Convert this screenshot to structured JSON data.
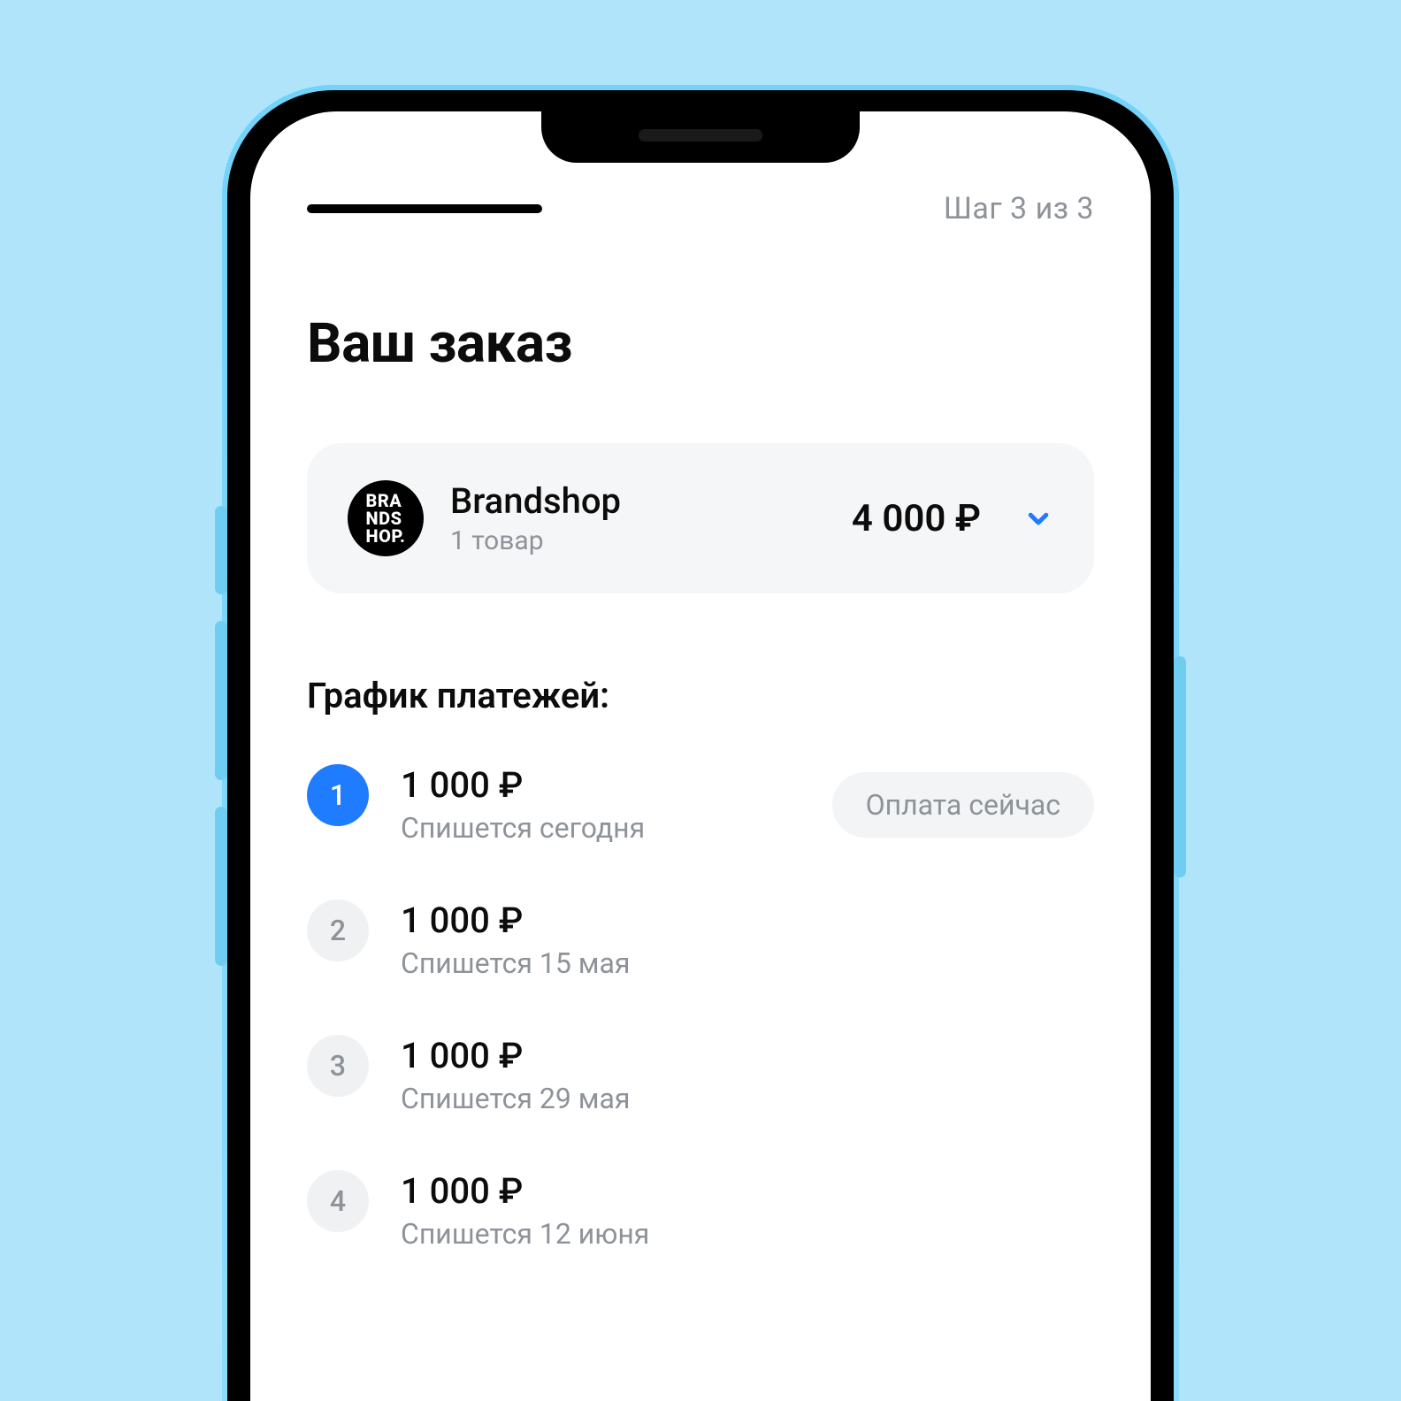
{
  "header": {
    "step_label": "Шаг 3 из 3"
  },
  "title": "Ваш заказ",
  "order": {
    "logo_text": "BRA\nNDS\nHOP.",
    "merchant": "Brandshop",
    "items_label": "1 товар",
    "total": "4 000 ₽"
  },
  "schedule": {
    "title": "График платежей:",
    "pay_now_badge": "Оплата сейчас",
    "rows": [
      {
        "n": "1",
        "amount": "1 000 ₽",
        "date": "Спишется сегодня",
        "active": true,
        "badge": true
      },
      {
        "n": "2",
        "amount": "1 000 ₽",
        "date": "Спишется 15 мая",
        "active": false,
        "badge": false
      },
      {
        "n": "3",
        "amount": "1 000 ₽",
        "date": "Спишется 29 мая",
        "active": false,
        "badge": false
      },
      {
        "n": "4",
        "amount": "1 000 ₽",
        "date": "Спишется 12 июня",
        "active": false,
        "badge": false
      }
    ]
  }
}
